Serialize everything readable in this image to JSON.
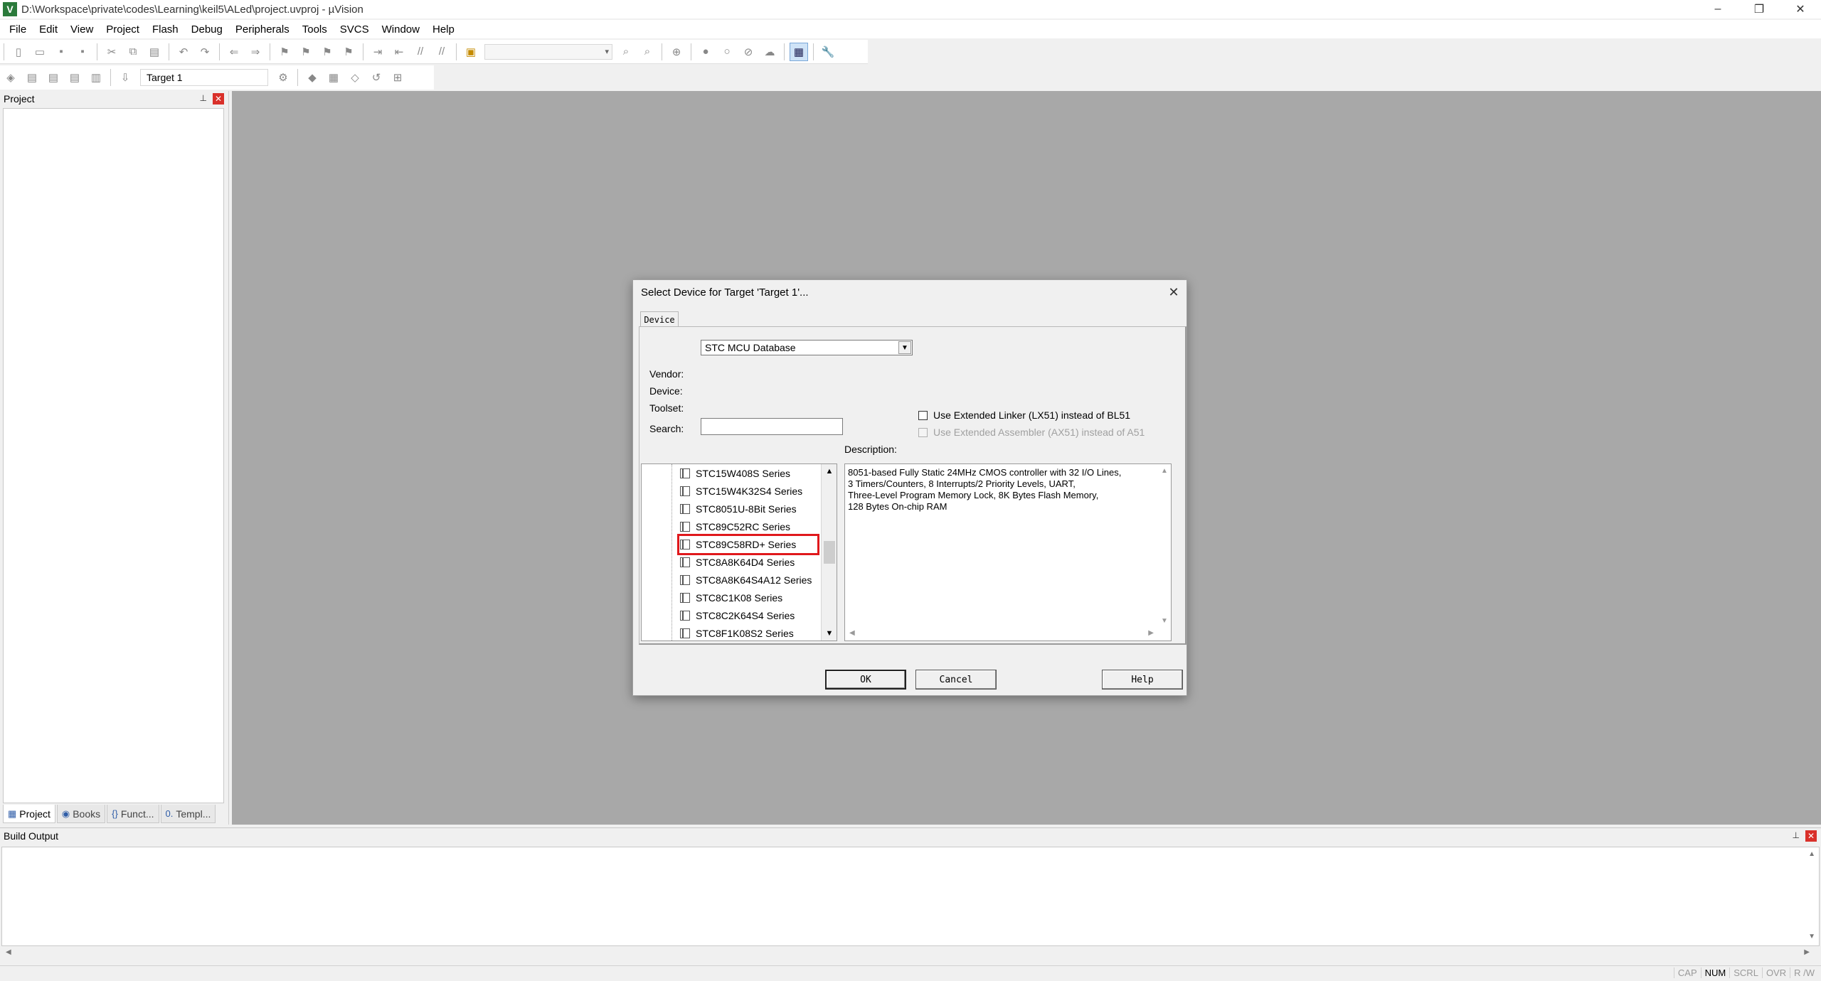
{
  "window": {
    "title": "D:\\Workspace\\private\\codes\\Learning\\keil5\\ALed\\project.uvproj - µVision",
    "app_icon": "V",
    "controls": [
      "–",
      "❐",
      "✕"
    ]
  },
  "menu": [
    "File",
    "Edit",
    "View",
    "Project",
    "Flash",
    "Debug",
    "Peripherals",
    "Tools",
    "SVCS",
    "Window",
    "Help"
  ],
  "toolbar": {
    "target": "Target 1"
  },
  "project_panel": {
    "title": "Project",
    "tabs": [
      {
        "icon": "▦",
        "label": "Project"
      },
      {
        "icon": "◉",
        "label": "Books"
      },
      {
        "icon": "{}",
        "label": "Funct..."
      },
      {
        "icon": "0.",
        "label": "Templ..."
      }
    ]
  },
  "build_output": {
    "title": "Build Output"
  },
  "status": [
    "CAP",
    "NUM",
    "SCRL",
    "OVR",
    "R /W"
  ],
  "dialog": {
    "title": "Select Device for Target 'Target 1'...",
    "tab": "Device",
    "database": "STC MCU Database",
    "labels": {
      "vendor": "Vendor:",
      "device": "Device:",
      "toolset": "Toolset:",
      "search": "Search:",
      "description": "Description:"
    },
    "search_value": "",
    "checkboxes": {
      "extended_linker": "Use Extended Linker (LX51) instead of BL51",
      "extended_assembler": "Use Extended Assembler (AX51) instead of A51"
    },
    "devices": [
      "STC15W408S Series",
      "STC15W4K32S4 Series",
      "STC8051U-8Bit Series",
      "STC89C52RC Series",
      "STC89C58RD+ Series",
      "STC8A8K64D4 Series",
      "STC8A8K64S4A12 Series",
      "STC8C1K08 Series",
      "STC8C2K64S4 Series",
      "STC8F1K08S2 Series"
    ],
    "selected_device": "STC89C58RD+ Series",
    "description": "8051-based Fully Static 24MHz CMOS controller with 32  I/O Lines,\n3 Timers/Counters, 8 Interrupts/2 Priority Levels, UART,\nThree-Level Program Memory Lock, 8K Bytes Flash Memory,\n128 Bytes On-chip RAM",
    "buttons": {
      "ok": "OK",
      "cancel": "Cancel",
      "help": "Help"
    }
  }
}
